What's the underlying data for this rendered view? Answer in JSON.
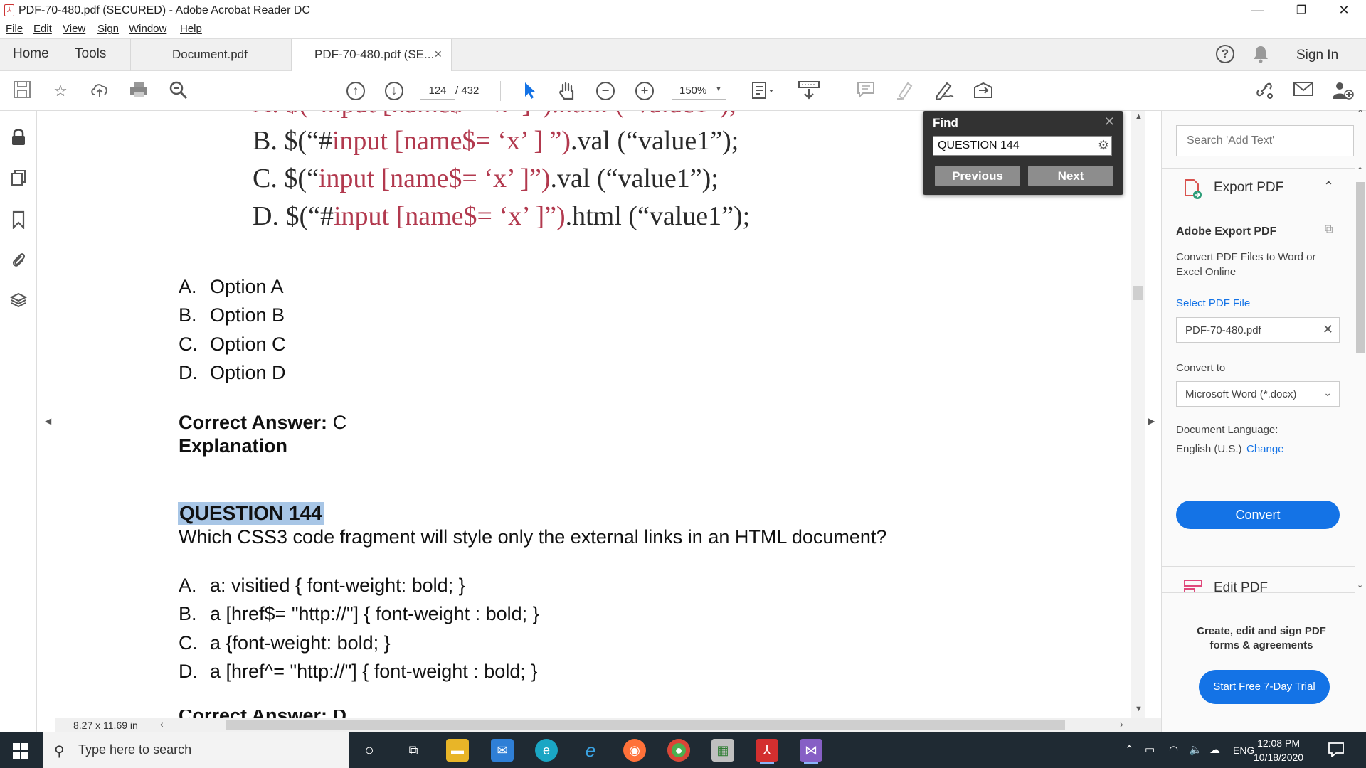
{
  "window": {
    "title": "PDF-70-480.pdf (SECURED) - Adobe Acrobat Reader DC",
    "minimize": "—",
    "restore": "❐",
    "close": "✕"
  },
  "menu": [
    "File",
    "Edit",
    "View",
    "Sign",
    "Window",
    "Help"
  ],
  "tabs": {
    "home": "Home",
    "tools": "Tools",
    "doc1": "Document.pdf",
    "doc2": "PDF-70-480.pdf (SE...",
    "doc2_close": "✕",
    "sign_in": "Sign In"
  },
  "toolbar": {
    "current_page": "124",
    "total_pages": "/ 432",
    "zoom": "150%",
    "icons": [
      "save-icon",
      "star-icon",
      "upload-icon",
      "print-icon",
      "zoom-search-icon",
      "prev-page-icon",
      "next-page-icon",
      "select-cursor-icon",
      "hand-icon",
      "zoom-out-icon",
      "zoom-in-icon",
      "fit-page-icon",
      "scroll-mode-icon",
      "comment-icon",
      "highlight-icon",
      "sign-icon",
      "send-icon",
      "share-link-icon",
      "email-icon",
      "add-user-icon"
    ]
  },
  "document": {
    "code_lines": [
      {
        "prefix": "B. $(“#",
        "mid": "input [name$= ‘x’ ] ”)",
        "suffix": ".val (“value1”);"
      },
      {
        "prefix": "C. $(“",
        "mid": "input [name$= ‘x’ ]”)",
        "suffix": ".val (“value1”);"
      },
      {
        "prefix": "D. $(“#",
        "mid": "input [name$= ‘x’ ]”)",
        "suffix": ".html (“value1”);"
      }
    ],
    "options_prev": [
      {
        "letter": "A.",
        "text": "Option A"
      },
      {
        "letter": "B.",
        "text": "Option B"
      },
      {
        "letter": "C.",
        "text": "Option C"
      },
      {
        "letter": "D.",
        "text": "Option D"
      }
    ],
    "correct_label": "Correct Answer:",
    "correct_value": " C",
    "explanation": "Explanation",
    "question_heading": "QUESTION 144",
    "question_text": "Which CSS3 code fragment will style only the external links in an HTML document?",
    "options_q144": [
      {
        "letter": "A.",
        "text": "a: visitied { font-weight: bold; }"
      },
      {
        "letter": "B.",
        "text": "a [href$= \"http://\"] { font-weight : bold; }"
      },
      {
        "letter": "C.",
        "text": "a {font-weight: bold; }"
      },
      {
        "letter": "D.",
        "text": "a [href^= \"http://\"] { font-weight : bold; }"
      }
    ],
    "page_size": "8.27 x 11.69 in"
  },
  "find": {
    "title": "Find",
    "close": "✕",
    "value": "QUESTION 144",
    "previous": "Previous",
    "next": "Next"
  },
  "right_panel": {
    "search_placeholder": "Search 'Add Text'",
    "export_title": "Export PDF",
    "adobe_export_title": "Adobe Export PDF",
    "description": "Convert PDF Files to Word or Excel Online",
    "select_file_label": "Select PDF File",
    "selected_file": "PDF-70-480.pdf",
    "convert_to_label": "Convert to",
    "convert_to_value": "Microsoft Word (*.docx)",
    "doc_language_label": "Document Language:",
    "doc_language_value": "English (U.S.)",
    "change_link": "Change",
    "convert_button": "Convert",
    "edit_pdf": "Edit PDF",
    "promo_text": "Create, edit and sign PDF forms & agreements",
    "trial_button": "Start Free 7-Day Trial"
  },
  "taskbar": {
    "search_placeholder": "Type here to search",
    "language": "ENG",
    "time": "12:08 PM",
    "date": "10/18/2020"
  },
  "colors": {
    "accent": "#1473e6",
    "find_bg": "#323232",
    "highlight": "#a8c6e6",
    "taskbar": "#1f2a33"
  }
}
